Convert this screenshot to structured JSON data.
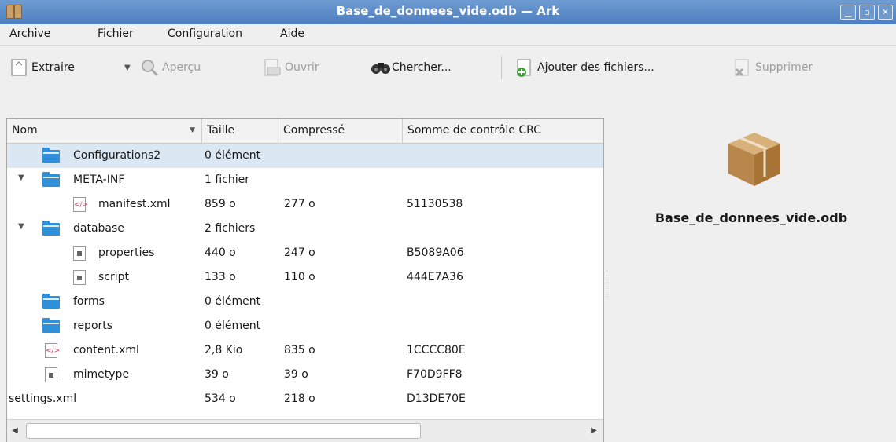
{
  "window": {
    "title": "Base_de_donnees_vide.odb — Ark"
  },
  "menubar": [
    {
      "label": "Archive"
    },
    {
      "label": "Fichier"
    },
    {
      "label": "Configuration"
    },
    {
      "label": "Aide"
    }
  ],
  "toolbar": {
    "extract": "Extraire",
    "preview": "Aperçu",
    "open": "Ouvrir",
    "find": "Chercher...",
    "add": "Ajouter des fichiers...",
    "delete": "Supprimer"
  },
  "columns": {
    "name": "Nom",
    "size": "Taille",
    "compressed": "Compressé",
    "crc": "Somme de contrôle CRC"
  },
  "rows": [
    {
      "name": "Configurations2",
      "size": "0 élément",
      "compressed": "",
      "crc": "",
      "icon": "folder-icon",
      "selected": true
    },
    {
      "name": "META-INF",
      "size": "1 fichier",
      "compressed": "",
      "crc": "",
      "icon": "folder-icon",
      "expanded": true
    },
    {
      "name": "manifest.xml",
      "size": "859 o",
      "compressed": "277 o",
      "crc": "51130538",
      "icon": "xml-file-icon"
    },
    {
      "name": "database",
      "size": "2 fichiers",
      "compressed": "",
      "crc": "",
      "icon": "folder-icon",
      "expanded": true
    },
    {
      "name": "properties",
      "size": "440 o",
      "compressed": "247 o",
      "crc": "B5089A06",
      "icon": "file-icon"
    },
    {
      "name": "script",
      "size": "133 o",
      "compressed": "110 o",
      "crc": "444E7A36",
      "icon": "file-icon"
    },
    {
      "name": "forms",
      "size": "0 élément",
      "compressed": "",
      "crc": "",
      "icon": "folder-icon"
    },
    {
      "name": "reports",
      "size": "0 élément",
      "compressed": "",
      "crc": "",
      "icon": "folder-icon"
    },
    {
      "name": "content.xml",
      "size": "2,8 Kio",
      "compressed": "835 o",
      "crc": "1CCCC80E",
      "icon": "xml-file-icon"
    },
    {
      "name": "mimetype",
      "size": "39 o",
      "compressed": "39 o",
      "crc": "F70D9FF8",
      "icon": "file-icon"
    },
    {
      "name": "settings.xml",
      "size": "534 o",
      "compressed": "218 o",
      "crc": "D13DE70E",
      "icon": "none"
    }
  ],
  "preview": {
    "filename": "Base_de_donnees_vide.odb",
    "icon": "package-box-icon"
  },
  "colors": {
    "titlebar": "#5b8ac8",
    "selection": "#dbe7f3",
    "folder": "#2f8fd8"
  }
}
